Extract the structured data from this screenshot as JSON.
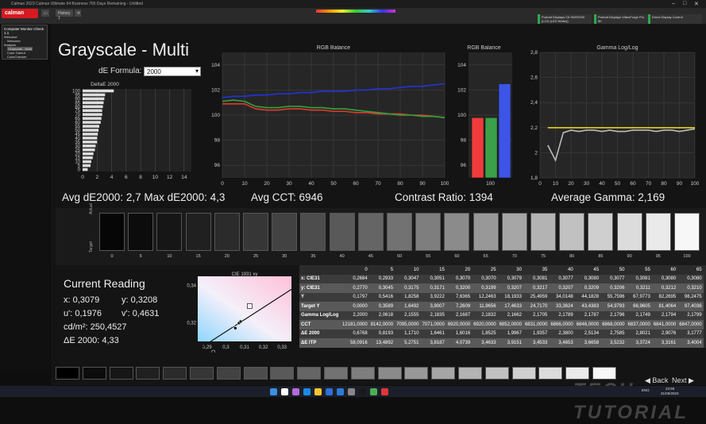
{
  "window_title": "Calman 2023 Calman Ultimate 64 Business 765 Days Remaining - Untitled",
  "logo": "calman",
  "tabs": [
    {
      "label": "History 1"
    }
  ],
  "topbar_icons": [
    "tab-icon",
    "sync-icon"
  ],
  "devices": [
    {
      "label": "Portrait Displays C6 HDR2000 (LCD (LED White))"
    },
    {
      "label": "Portrait Displays VideoForge Pro 8K"
    },
    {
      "label": "Direct Display Control"
    }
  ],
  "sidebar": {
    "header": "Computer Monitor Check 1.1",
    "items": [
      "Welcome",
      "Welcome",
      "Analysis",
      "Grayscale - Multi",
      "Color Gamut",
      "ColorChecker"
    ]
  },
  "page_title": "Grayscale - Multi",
  "de_formula": {
    "label": "dE Formula:",
    "value": "2000"
  },
  "stats": {
    "avg_de": "Avg dE2000: 2,7 Max dE2000: 4,3",
    "avg_cct": "Avg CCT: 6946",
    "contrast": "Contrast Ratio: 1394",
    "avg_gamma": "Average Gamma: 2,169"
  },
  "chart_data": [
    {
      "type": "bar",
      "title": "DeltaE 2000",
      "orientation": "horizontal",
      "categories": [
        "0",
        "5",
        "10",
        "15",
        "20",
        "25",
        "30",
        "35",
        "40",
        "45",
        "50",
        "55",
        "60",
        "65",
        "70",
        "75",
        "80",
        "85",
        "90",
        "95",
        "100"
      ],
      "values": [
        0.7,
        1.1,
        1.2,
        1.4,
        1.5,
        1.7,
        1.8,
        2.0,
        2.0,
        2.1,
        2.2,
        2.3,
        2.5,
        2.6,
        2.7,
        2.7,
        2.8,
        2.9,
        3.0,
        3.1,
        4.3
      ],
      "y_tick_labels": [
        "0",
        "5",
        "10",
        "15",
        "20",
        "25",
        "30",
        "35",
        "40",
        "45",
        "50",
        "55",
        "60",
        "65",
        "70",
        "75",
        "80",
        "85",
        "90",
        "95",
        "100"
      ],
      "x_tick_labels": [
        "0",
        "2",
        "4",
        "6",
        "8",
        "10",
        "12",
        "14"
      ],
      "xlim": [
        0,
        15
      ]
    },
    {
      "type": "line",
      "title": "RGB Balance",
      "x": [
        0,
        5,
        10,
        15,
        20,
        25,
        30,
        35,
        40,
        45,
        50,
        55,
        60,
        65,
        70,
        75,
        80,
        85,
        90,
        95,
        100
      ],
      "series": [
        {
          "color": "#e03a2f",
          "values": [
            100.9,
            100.9,
            100.9,
            100.5,
            100.4,
            100.4,
            100.5,
            100.5,
            100.4,
            100.4,
            100.3,
            100.3,
            100.2,
            100.2,
            100.1,
            100.1,
            100.1,
            100.0,
            100.0,
            99.9,
            99.8
          ]
        },
        {
          "color": "#33a33a",
          "values": [
            101.1,
            101.2,
            101.1,
            100.7,
            100.6,
            100.6,
            100.7,
            100.7,
            100.6,
            100.6,
            100.5,
            100.5,
            100.4,
            100.3,
            100.2,
            100.1,
            100.0,
            100.0,
            99.9,
            99.9,
            99.8
          ]
        },
        {
          "color": "#2233dd",
          "values": [
            101.4,
            101.5,
            101.5,
            101.6,
            101.6,
            101.7,
            101.7,
            101.8,
            101.8,
            101.9,
            101.9,
            101.9,
            102.0,
            102.0,
            102.1,
            102.1,
            102.2,
            102.3,
            102.3,
            102.4,
            102.5
          ]
        }
      ],
      "y_tick_labels": [
        "96",
        "98",
        "100",
        "102",
        "104"
      ],
      "x_tick_labels": [
        "0",
        "10",
        "20",
        "30",
        "40",
        "50",
        "60",
        "70",
        "80",
        "90",
        "100"
      ],
      "xlim": [
        0,
        100
      ],
      "ylim": [
        95,
        105
      ],
      "grid": true
    },
    {
      "type": "bar",
      "title": "RGB Balance",
      "categories": [
        "R",
        "G",
        "B"
      ],
      "values": [
        99.8,
        99.8,
        102.5
      ],
      "colors": [
        "#ef3b3b",
        "#3aa04a",
        "#3c55e8"
      ],
      "y_tick_labels": [
        "96",
        "98",
        "100",
        "102",
        "104"
      ],
      "x_tick_labels": [
        "100"
      ],
      "ylim": [
        95,
        105
      ]
    },
    {
      "type": "line",
      "title": "Gamma Log/Log",
      "x": [
        5,
        10,
        15,
        20,
        25,
        30,
        35,
        40,
        45,
        50,
        55,
        60,
        65,
        70,
        75,
        80,
        85,
        90,
        95,
        100
      ],
      "series": [
        {
          "color": "#bbbbbb",
          "values": [
            2.06,
            1.94,
            2.16,
            2.18,
            2.17,
            2.18,
            2.18,
            2.17,
            2.18,
            2.17,
            2.17,
            2.18,
            2.18,
            2.18,
            2.17,
            2.18,
            2.18,
            2.17,
            2.18,
            2.19
          ]
        },
        {
          "color": "#e6cf1a",
          "values": [
            2.2,
            2.2,
            2.2,
            2.2,
            2.2,
            2.2,
            2.2,
            2.2,
            2.2,
            2.2,
            2.2,
            2.2,
            2.2,
            2.2,
            2.2,
            2.2,
            2.2,
            2.2,
            2.2,
            2.2
          ]
        }
      ],
      "y_tick_labels": [
        "1,8",
        "2",
        "2,2",
        "2,4",
        "2,6",
        "2,8"
      ],
      "x_tick_labels": [
        "0",
        "10",
        "20",
        "30",
        "40",
        "50",
        "60",
        "70",
        "80",
        "90",
        "100"
      ],
      "xlim": [
        0,
        100
      ],
      "ylim": [
        1.8,
        2.8
      ],
      "grid": true
    },
    {
      "type": "scatter",
      "title": "CIE 1931 xy",
      "x": [
        0.2684,
        0.2933,
        0.3047,
        0.3051,
        0.307,
        0.307,
        0.3079
      ],
      "y": [
        0.277,
        0.3045,
        0.3175,
        0.3171,
        0.32,
        0.3199,
        0.3207
      ],
      "target": [
        0.3127,
        0.329
      ],
      "x_tick_labels": [
        "0,29",
        "0,3",
        "0,31",
        "0,32",
        "0,33"
      ],
      "y_tick_labels": [
        "0,32",
        "0,34"
      ],
      "xlim": [
        0.285,
        0.335
      ],
      "ylim": [
        0.31,
        0.345
      ]
    }
  ],
  "swatches": {
    "row_labels": [
      "Actual",
      "Target"
    ],
    "items": [
      {
        "label": "0",
        "color": "#060606"
      },
      {
        "label": "5",
        "color": "#0c0c0c"
      },
      {
        "label": "10",
        "color": "#161616"
      },
      {
        "label": "15",
        "color": "#202020"
      },
      {
        "label": "20",
        "color": "#2b2b2b"
      },
      {
        "label": "25",
        "color": "#363636"
      },
      {
        "label": "30",
        "color": "#424242"
      },
      {
        "label": "35",
        "color": "#4d4d4d"
      },
      {
        "label": "40",
        "color": "#595959"
      },
      {
        "label": "45",
        "color": "#656565"
      },
      {
        "label": "50",
        "color": "#727272"
      },
      {
        "label": "55",
        "color": "#7e7e7e"
      },
      {
        "label": "60",
        "color": "#8b8b8b"
      },
      {
        "label": "65",
        "color": "#989898"
      },
      {
        "label": "70",
        "color": "#a6a6a6"
      },
      {
        "label": "75",
        "color": "#b3b3b3"
      },
      {
        "label": "80",
        "color": "#c1c1c1"
      },
      {
        "label": "85",
        "color": "#cfcfcf"
      },
      {
        "label": "90",
        "color": "#dcdcdc"
      },
      {
        "label": "95",
        "color": "#eaeaea"
      },
      {
        "label": "100",
        "color": "#f7f7f7"
      }
    ]
  },
  "current_reading": {
    "title": "Current Reading",
    "x": "x: 0,3079",
    "y": "y: 0,3208",
    "u": "u': 0,1976",
    "v": "v': 0,4631",
    "cdm2": "cd/m²: 250,4527",
    "de2000": "ΔE 2000: 4,33"
  },
  "table": {
    "headers": [
      "",
      "0",
      "5",
      "10",
      "15",
      "20",
      "25",
      "30",
      "35",
      "40",
      "45",
      "50",
      "55",
      "60",
      "65"
    ],
    "rows": [
      {
        "label": "x: CIE31",
        "cells": [
          "0,2684",
          "0,2933",
          "0,3047",
          "0,3051",
          "0,3070",
          "0,3070",
          "0,3079",
          "0,3081",
          "0,3077",
          "0,3080",
          "0,3077",
          "0,3081",
          "0,3080",
          "0,3080"
        ]
      },
      {
        "label": "y: CIE31",
        "cells": [
          "0,2770",
          "0,3045",
          "0,3175",
          "0,3171",
          "0,3200",
          "0,3199",
          "0,3207",
          "0,3217",
          "0,3207",
          "0,3209",
          "0,3206",
          "0,3211",
          "0,3212",
          "0,3210"
        ]
      },
      {
        "label": "Y",
        "cells": [
          "0,1797",
          "0,5416",
          "1,8258",
          "3,9222",
          "7,6365",
          "12,2463",
          "18,1933",
          "25,4959",
          "34,0148",
          "44,1828",
          "55,7596",
          "67,9773",
          "82,2695",
          "98,2475"
        ]
      },
      {
        "label": "Target Y",
        "cells": [
          "0,0000",
          "0,3589",
          "1,6492",
          "3,8007",
          "7,2609",
          "11,9656",
          "17,4633",
          "24,7170",
          "33,3624",
          "43,4383",
          "54,9793",
          "66,9605",
          "81,4064",
          "97,4036"
        ]
      },
      {
        "label": "Gamma Log/Log",
        "cells": [
          "2,2000",
          "2,0618",
          "2,1555",
          "2,1835",
          "2,1687",
          "2,1832",
          "2,1662",
          "2,1705",
          "2,1789",
          "2,1787",
          "2,1796",
          "2,1749",
          "2,1794",
          "2,1799"
        ]
      },
      {
        "label": "CCT",
        "cells": [
          "12181,0000",
          "8142,0000",
          "7095,0000",
          "7071,0000",
          "6920,0000",
          "6920,0000",
          "6852,0000",
          "6831,0000",
          "6866,0000",
          "6846,0000",
          "6868,0000",
          "6837,0000",
          "6841,0000",
          "6847,0000"
        ]
      },
      {
        "label": "ΔE 2000",
        "cells": [
          "0,6768",
          "0,8193",
          "1,1710",
          "1,6461",
          "1,6016",
          "1,8525",
          "1,9967",
          "1,9357",
          "2,3800",
          "2,5134",
          "2,7585",
          "2,8021",
          "2,9076",
          "3,1777"
        ]
      },
      {
        "label": "ΔE ITP",
        "cells": [
          "58,0916",
          "13,4892",
          "5,2751",
          "3,8187",
          "4,0739",
          "3,4633",
          "3,9151",
          "3,4533",
          "3,4653",
          "3,6658",
          "3,5232",
          "3,3724",
          "3,3161",
          "3,4004"
        ]
      }
    ]
  },
  "bottom_swatches": [
    "#000000",
    "#0c0c0c",
    "#161616",
    "#202020",
    "#2b2b2b",
    "#363636",
    "#424242",
    "#4d4d4d",
    "#595959",
    "#656565",
    "#727272",
    "#7e7e7e",
    "#8b8b8b",
    "#989898",
    "#a6a6a6",
    "#b3b3b3",
    "#c1c1c1",
    "#cfcfcf",
    "#dcdcdc",
    "#eaeaea",
    "#f7f7f7"
  ],
  "nav": {
    "back": "Back",
    "next": "Next"
  },
  "watermark": "TECH TUTORIAL",
  "taskbar": {
    "time": "23:59",
    "date": "31/05/2023",
    "lang": "ENG",
    "icons": [
      "windows-icon",
      "search-icon",
      "files-icon",
      "edge-icon",
      "folder-icon",
      "store-icon",
      "mail-icon",
      "settings-icon",
      "steam-icon",
      "chrome-icon",
      "calman-icon"
    ],
    "icon_colors": [
      "#3b8ee0",
      "#ffffff",
      "#b66ad6",
      "#1e88e5",
      "#f4c430",
      "#2f6ed7",
      "#2b7bd6",
      "#888888",
      "#1a1a1a",
      "#4caf50",
      "#e03535"
    ]
  }
}
